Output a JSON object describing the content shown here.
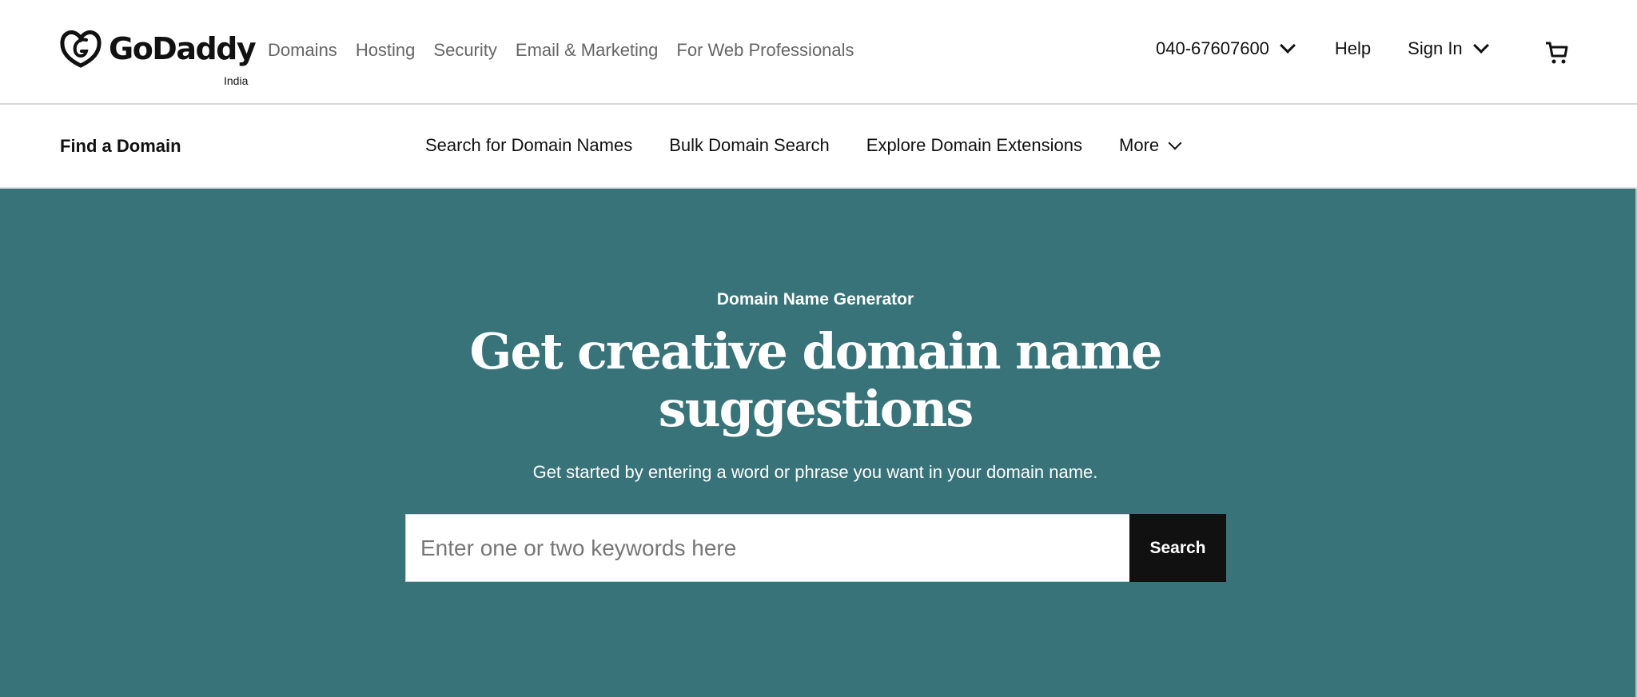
{
  "header": {
    "logo_text": "GoDaddy",
    "logo_region": "India",
    "nav": [
      "Domains",
      "Hosting",
      "Security",
      "Email & Marketing",
      "For Web Professionals"
    ],
    "phone": "040-67607600",
    "help": "Help",
    "sign_in": "Sign In"
  },
  "subnav": {
    "title": "Find a Domain",
    "links": [
      "Search for Domain Names",
      "Bulk Domain Search",
      "Explore Domain Extensions"
    ],
    "more": "More"
  },
  "hero": {
    "eyebrow": "Domain Name Generator",
    "headline_line1": "Get creative domain name",
    "headline_line2": "suggestions",
    "subtext": "Get started by entering a word or phrase you want in your domain name.",
    "search_placeholder": "Enter one or two keywords here",
    "search_value": "",
    "search_button": "Search",
    "background_color": "#377379"
  }
}
